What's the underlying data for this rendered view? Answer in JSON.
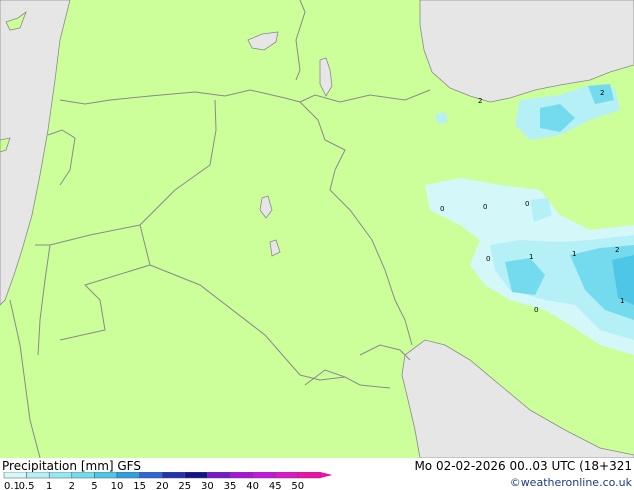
{
  "title": "Precipitation [mm]  GFS",
  "datetime": "Mo 02-02-2026 00..03 UTC (18+321",
  "credit": "©weatheronline.co.uk",
  "legend": {
    "labels": [
      "0.1",
      "0.5",
      "1",
      "2",
      "5",
      "10",
      "15",
      "20",
      "25",
      "30",
      "35",
      "40",
      "45",
      "50"
    ],
    "colors": [
      "#d4f7f9",
      "#b4f0f5",
      "#96e7f2",
      "#74dbee",
      "#4ec6e8",
      "#2f9fe0",
      "#2f66d6",
      "#2233b0",
      "#14148a",
      "#7a18c8",
      "#a418d8",
      "#c418dc",
      "#dc18c8",
      "#ee10a8"
    ]
  },
  "colors": {
    "land": "#ccff99",
    "sea": "#e6e6e6",
    "border": "#8a8a8a"
  },
  "precip_labels": [
    "2",
    "2",
    "0",
    "0",
    "0",
    "0",
    "1",
    "1",
    "2",
    "1",
    "0"
  ]
}
